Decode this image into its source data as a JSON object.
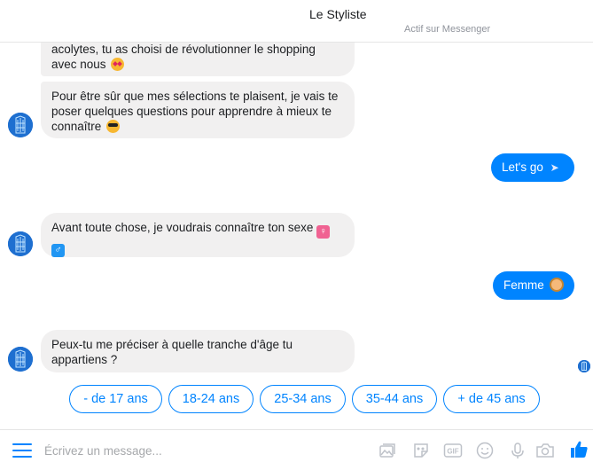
{
  "header": {
    "title": "Le Styliste",
    "status": "Actif sur Messenger"
  },
  "messages": {
    "m1": {
      "text": "acolytes, tu as choisi de révolutionner le shopping avec nous",
      "emoji": "star-struck-emoji"
    },
    "m2": {
      "text": "Pour être sûr que mes sélections te plaisent, je vais te poser quelques questions pour apprendre à mieux te connaître",
      "emoji": "sunglasses-emoji"
    },
    "m3": {
      "text": "Let's go",
      "emoji": "rocket-emoji"
    },
    "m4": {
      "text": "Avant toute chose, je voudrais connaître ton sexe",
      "emoji_female": "♀",
      "emoji_male": "♂"
    },
    "m5": {
      "text": "Femme",
      "emoji": "woman-emoji"
    },
    "m6": {
      "text": "Peux-tu me préciser à quelle tranche d'âge tu appartiens ?"
    }
  },
  "quick_replies": [
    "- de 17 ans",
    "18-24 ans",
    "25-34 ans",
    "35-44 ans",
    "+ de 45 ans"
  ],
  "composer": {
    "placeholder": "Écrivez un message...",
    "icons": [
      "menu-icon",
      "photo-icon",
      "sticker-icon",
      "gif-icon",
      "emoji-icon",
      "microphone-icon",
      "camera-icon",
      "thumbs-up-icon"
    ]
  },
  "colors": {
    "accent": "#0084ff",
    "bubble_in": "#f1f0f0",
    "avatar": "#1e6fd0"
  }
}
